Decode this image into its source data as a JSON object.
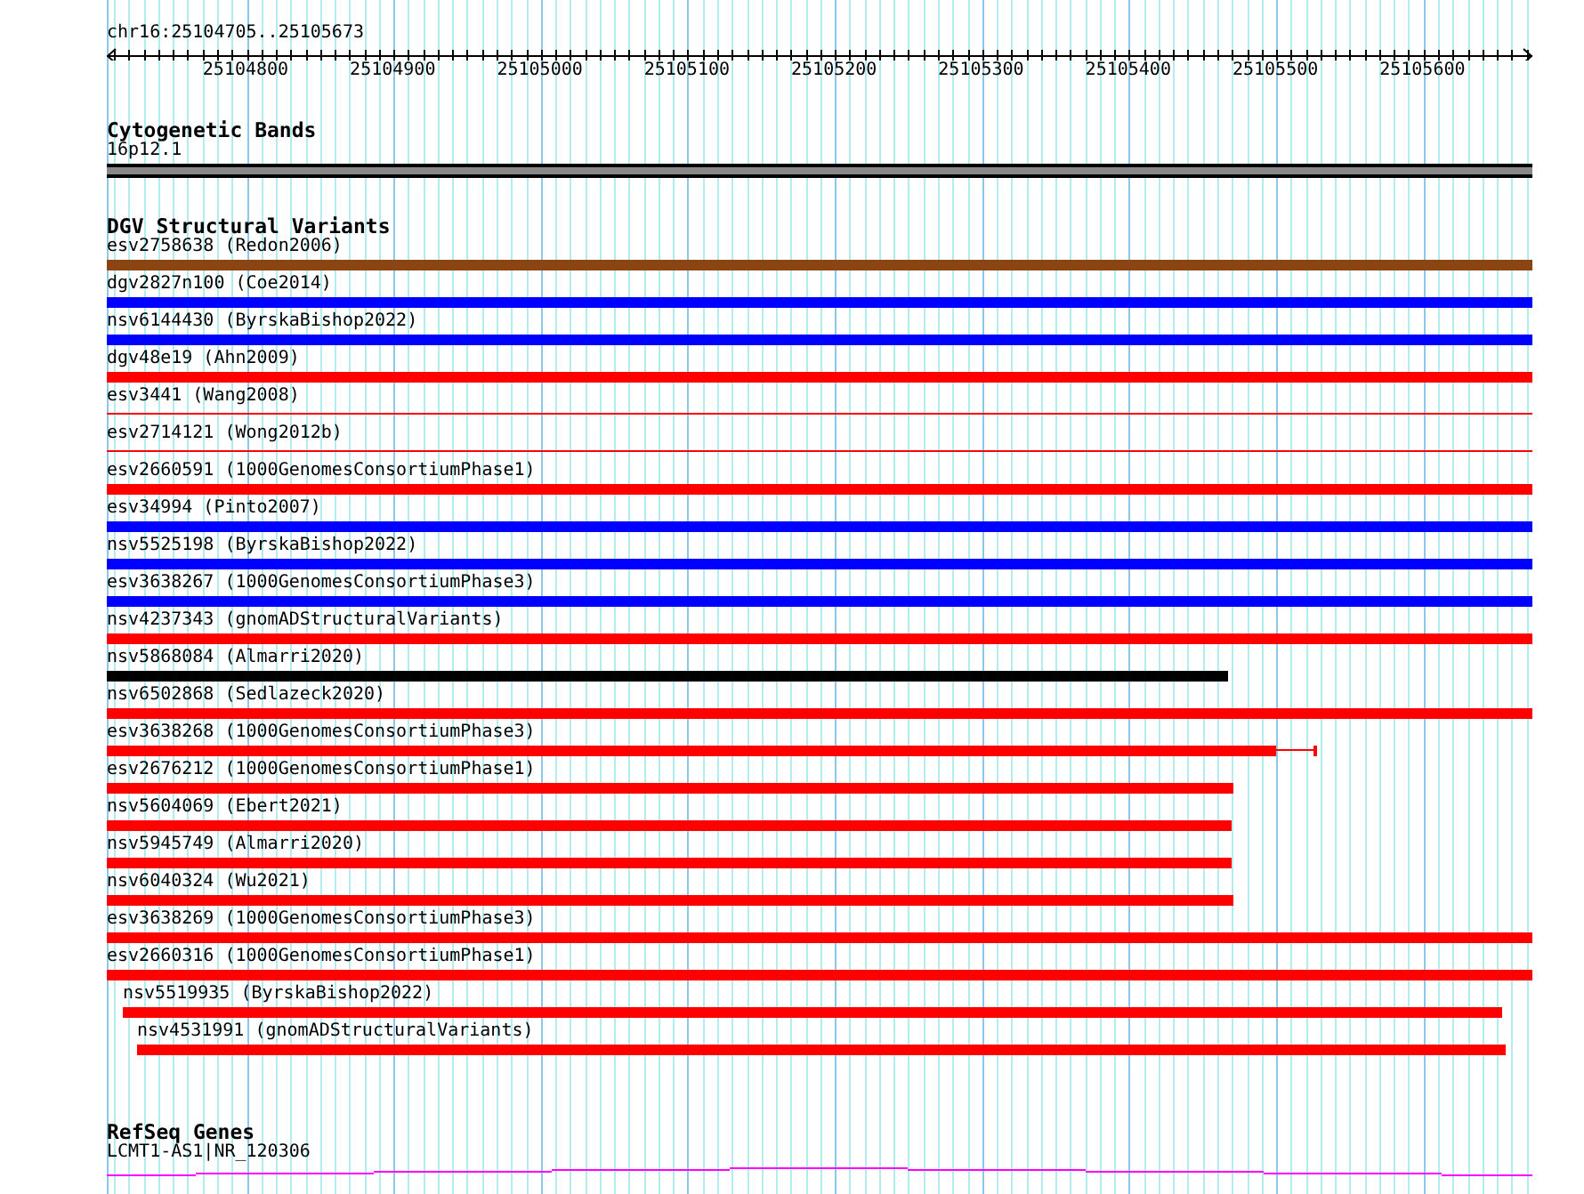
{
  "ruler": {
    "location": "chr16:25104705..25105673",
    "ticks": [
      "25104800",
      "25104900",
      "25105000",
      "25105100",
      "25105200",
      "25105300",
      "25105400",
      "25105500",
      "25105600"
    ]
  },
  "cytogenetic_bands": {
    "title": "Cytogenetic Bands",
    "band": "16p12.1"
  },
  "dgv_structural_variants": {
    "title": "DGV Structural Variants",
    "variants": [
      {
        "label": "esv2758638 (Redon2006)",
        "kind": "bar",
        "color": "#8b4513"
      },
      {
        "label": "dgv2827n100 (Coe2014)",
        "kind": "bar",
        "color": "#0000ff"
      },
      {
        "label": "nsv6144430 (ByrskaBishop2022)",
        "kind": "bar",
        "color": "#0000ff"
      },
      {
        "label": "dgv48e19 (Ahn2009)",
        "kind": "bar",
        "color": "#ff0000"
      },
      {
        "label": "esv3441 (Wang2008)",
        "kind": "line",
        "color": "#ff0000"
      },
      {
        "label": "esv2714121 (Wong2012b)",
        "kind": "line",
        "color": "#ff0000"
      },
      {
        "label": "esv2660591 (1000GenomesConsortiumPhase1)",
        "kind": "bar",
        "color": "#ff0000"
      },
      {
        "label": "esv34994 (Pinto2007)",
        "kind": "bar",
        "color": "#0000ff"
      },
      {
        "label": "nsv5525198 (ByrskaBishop2022)",
        "kind": "bar",
        "color": "#0000ff"
      },
      {
        "label": "esv3638267 (1000GenomesConsortiumPhase3)",
        "kind": "bar",
        "color": "#0000ff"
      },
      {
        "label": "nsv4237343 (gnomADStructuralVariants)",
        "kind": "bar",
        "color": "#ff0000"
      },
      {
        "label": "nsv5868084 (Almarri2020)",
        "kind": "bar",
        "color": "#000000"
      },
      {
        "label": "nsv6502868 (Sedlazeck2020)",
        "kind": "bar",
        "color": "#ff0000"
      },
      {
        "label": "esv3638268 (1000GenomesConsortiumPhase3)",
        "kind": "whisker",
        "color": "#ff0000"
      },
      {
        "label": "esv2676212 (1000GenomesConsortiumPhase1)",
        "kind": "bar",
        "color": "#ff0000"
      },
      {
        "label": "nsv5604069 (Ebert2021)",
        "kind": "bar",
        "color": "#ff0000"
      },
      {
        "label": "nsv5945749 (Almarri2020)",
        "kind": "bar",
        "color": "#ff0000"
      },
      {
        "label": "nsv6040324 (Wu2021)",
        "kind": "bar",
        "color": "#ff0000"
      },
      {
        "label": "esv3638269 (1000GenomesConsortiumPhase3)",
        "kind": "bar",
        "color": "#ff0000"
      },
      {
        "label": "esv2660316 (1000GenomesConsortiumPhase1)",
        "kind": "bar",
        "color": "#ff0000"
      },
      {
        "label": "nsv5519935 (ByrskaBishop2022)",
        "kind": "bar",
        "color": "#ff0000"
      },
      {
        "label": "nsv4531991 (gnomADStructuralVariants)",
        "kind": "bar",
        "color": "#ff0000"
      }
    ]
  },
  "refseq_genes": {
    "title": "RefSeq Genes",
    "gene": "LCMT1-AS1|NR_120306"
  }
}
